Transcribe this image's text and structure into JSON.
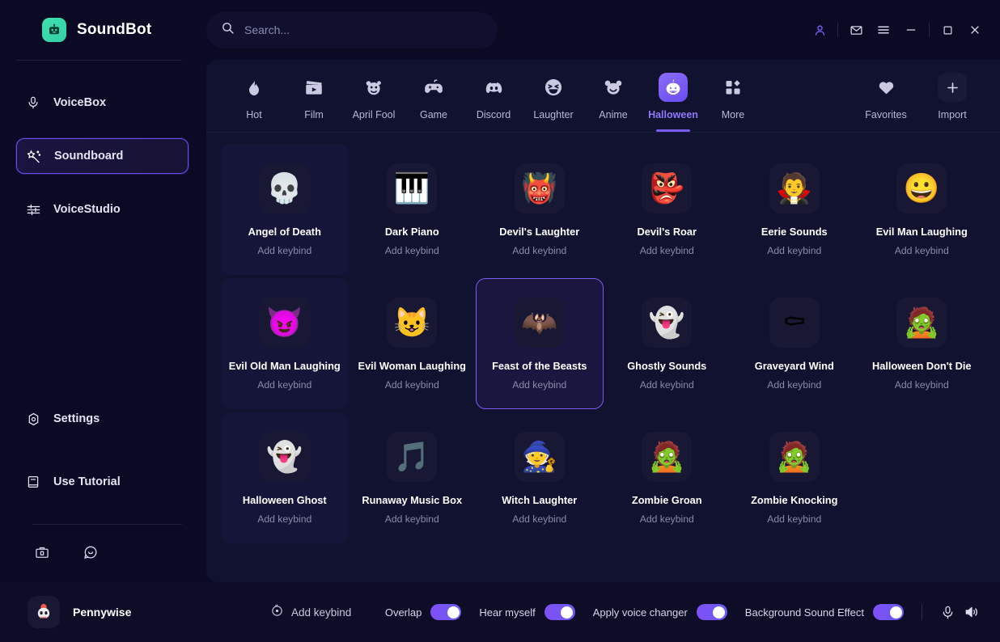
{
  "app": {
    "brand": "SoundBot",
    "brand_accent": "#3fd9ac"
  },
  "search": {
    "placeholder": "Search...",
    "value": ""
  },
  "titlebar": {
    "account_icon": "user-icon",
    "mail_icon": "mail-icon",
    "menu_icon": "hamburger-menu-icon",
    "minimize_icon": "minimize-icon",
    "maximize_icon": "maximize-icon",
    "close_icon": "close-icon"
  },
  "sidebar": {
    "items": [
      {
        "label": "VoiceBox",
        "icon": "microphone-icon",
        "active": false
      },
      {
        "label": "Soundboard",
        "icon": "magic-wand-icon",
        "active": true
      },
      {
        "label": "VoiceStudio",
        "icon": "sliders-icon",
        "active": false
      }
    ],
    "bottom_items": [
      {
        "label": "Settings",
        "icon": "gear-icon"
      },
      {
        "label": "Use Tutorial",
        "icon": "book-icon"
      }
    ],
    "mini_icons": [
      {
        "name": "toolbox-icon"
      },
      {
        "name": "chat-bubble-icon"
      }
    ]
  },
  "tabs": {
    "categories": [
      {
        "label": "Hot",
        "icon": "flame-icon",
        "glyph": "🔥",
        "active": false
      },
      {
        "label": "Film",
        "icon": "clapperboard-icon",
        "glyph": "🎬",
        "active": false
      },
      {
        "label": "April Fool",
        "icon": "clown-icon",
        "glyph": "🤡",
        "active": false
      },
      {
        "label": "Game",
        "icon": "gamepad-icon",
        "glyph": "🎮",
        "active": false
      },
      {
        "label": "Discord",
        "icon": "discord-icon",
        "glyph": "👾",
        "active": false
      },
      {
        "label": "Laughter",
        "icon": "laughing-face-icon",
        "glyph": "😂",
        "active": false
      },
      {
        "label": "Anime",
        "icon": "bear-face-icon",
        "glyph": "🐻",
        "active": false
      },
      {
        "label": "Halloween",
        "icon": "pumpkin-icon",
        "glyph": "🎃",
        "active": true
      },
      {
        "label": "More",
        "icon": "grid-squares-icon",
        "glyph": "▦",
        "active": false
      }
    ],
    "right": [
      {
        "label": "Favorites",
        "icon": "heart-icon",
        "glyph": "❤",
        "boxed": false
      },
      {
        "label": "Import",
        "icon": "plus-icon",
        "glyph": "＋",
        "boxed": true
      }
    ]
  },
  "soundboard": {
    "keybind_label": "Add keybind",
    "cards": [
      {
        "name": "Angel of Death",
        "keybind": "Add keybind",
        "glyph": "💀",
        "icon": "grim-reaper-skull-icon",
        "selected": false,
        "hover": true
      },
      {
        "name": "Dark Piano",
        "keybind": "Add keybind",
        "glyph": "🎹",
        "icon": "grand-piano-icon",
        "selected": false,
        "hover": false
      },
      {
        "name": "Devil's Laughter",
        "keybind": "Add keybind",
        "glyph": "👹",
        "icon": "red-devil-icon",
        "selected": false,
        "hover": false
      },
      {
        "name": "Devil's Roar",
        "keybind": "Add keybind",
        "glyph": "👺",
        "icon": "roaring-devil-icon",
        "selected": false,
        "hover": false
      },
      {
        "name": "Eerie Sounds",
        "keybind": "Add keybind",
        "glyph": "🧛",
        "icon": "eerie-creature-icon",
        "selected": false,
        "hover": false
      },
      {
        "name": "Evil Man Laughing",
        "keybind": "Add keybind",
        "glyph": "😀",
        "icon": "evil-man-face-icon",
        "selected": false,
        "hover": false
      },
      {
        "name": "Evil Old Man Laughing",
        "keybind": "Add keybind",
        "glyph": "😈",
        "icon": "evil-old-man-icon",
        "selected": false,
        "hover": true
      },
      {
        "name": "Evil Woman Laughing",
        "keybind": "Add keybind",
        "glyph": "😺",
        "icon": "evil-woman-devil-icon",
        "selected": false,
        "hover": false
      },
      {
        "name": "Feast of the Beasts",
        "keybind": "Add keybind",
        "glyph": "🦇",
        "icon": "bat-skull-candy-icon",
        "selected": true,
        "hover": false
      },
      {
        "name": "Ghostly Sounds",
        "keybind": "Add keybind",
        "glyph": "👻",
        "icon": "white-ghost-icon",
        "selected": false,
        "hover": false
      },
      {
        "name": "Graveyard Wind",
        "keybind": "Add keybind",
        "glyph": "⚰",
        "icon": "rip-tombstone-wind-icon",
        "selected": false,
        "hover": false
      },
      {
        "name": "Halloween Don't Die",
        "keybind": "Add keybind",
        "glyph": "🧟",
        "icon": "zombie-hand-grave-icon",
        "selected": false,
        "hover": false
      },
      {
        "name": "Halloween Ghost",
        "keybind": "Add keybind",
        "glyph": "👻",
        "icon": "angry-ghost-icon",
        "selected": false,
        "hover": true
      },
      {
        "name": "Runaway Music Box",
        "keybind": "Add keybind",
        "glyph": "🎵",
        "icon": "music-box-ghost-icon",
        "selected": false,
        "hover": false
      },
      {
        "name": "Witch Laughter",
        "keybind": "Add keybind",
        "glyph": "🧙",
        "icon": "witch-hat-face-icon",
        "selected": false,
        "hover": false
      },
      {
        "name": "Zombie Groan",
        "keybind": "Add keybind",
        "glyph": "🧟",
        "icon": "zombie-head-icon",
        "selected": false,
        "hover": false
      },
      {
        "name": "Zombie Knocking",
        "keybind": "Add keybind",
        "glyph": "🧟",
        "icon": "zombie-walking-icon",
        "selected": false,
        "hover": false
      }
    ]
  },
  "bottombar": {
    "voice_name": "Pennywise",
    "voice_avatar_icon": "clown-skull-icon",
    "voice_avatar_glyph": "🤡",
    "add_keybind": "Add keybind",
    "toggles": [
      {
        "label": "Overlap",
        "on": true
      },
      {
        "label": "Hear myself",
        "on": true
      },
      {
        "label": "Apply voice changer",
        "on": true
      },
      {
        "label": "Background Sound Effect",
        "on": true
      }
    ],
    "mic_icon": "microphone-icon",
    "speaker_icon": "speaker-volume-icon"
  },
  "colors": {
    "accent": "#7b5cf2",
    "bg": "#0a0a24",
    "panel": "#111130",
    "bottom": "#0d0d28",
    "toggle_on": "#7f4ff5"
  }
}
